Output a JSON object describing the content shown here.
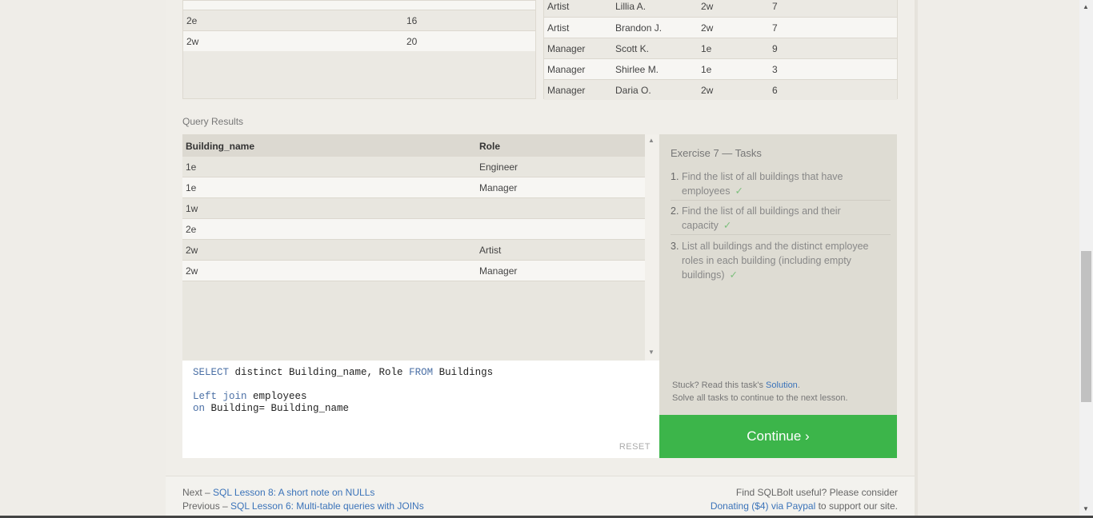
{
  "buildings_table": {
    "rows": [
      {
        "building": "2e",
        "capacity": "16"
      },
      {
        "building": "2w",
        "capacity": "20"
      }
    ]
  },
  "employees_table": {
    "rows": [
      {
        "role": "Artist",
        "name": "Lillia A.",
        "building": "2w",
        "years": "7"
      },
      {
        "role": "Artist",
        "name": "Brandon J.",
        "building": "2w",
        "years": "7"
      },
      {
        "role": "Manager",
        "name": "Scott K.",
        "building": "1e",
        "years": "9"
      },
      {
        "role": "Manager",
        "name": "Shirlee M.",
        "building": "1e",
        "years": "3"
      },
      {
        "role": "Manager",
        "name": "Daria O.",
        "building": "2w",
        "years": "6"
      }
    ]
  },
  "query_results": {
    "label": "Query Results",
    "columns": [
      "Building_name",
      "Role"
    ],
    "rows": [
      [
        "1e",
        "Engineer"
      ],
      [
        "1e",
        "Manager"
      ],
      [
        "1w",
        ""
      ],
      [
        "2e",
        ""
      ],
      [
        "2w",
        "Artist"
      ],
      [
        "2w",
        "Manager"
      ]
    ]
  },
  "editor": {
    "line1_kw1": "SELECT",
    "line1_rest": " distinct Building_name, Role ",
    "line1_kw2": "FROM",
    "line1_end": " Buildings",
    "line3_kw": "Left join",
    "line3_rest": " employees",
    "line4_kw": "on",
    "line4_rest": " Building= Building_name",
    "reset_label": "RESET"
  },
  "tasks": {
    "title": "Exercise 7 — Tasks",
    "items": [
      {
        "num": "1.",
        "text": "Find the list of all buildings that have employees",
        "check": "✓"
      },
      {
        "num": "2.",
        "text": "Find the list of all buildings and their capacity",
        "check": "✓"
      },
      {
        "num": "3.",
        "text": "List all buildings and the distinct employee roles in each building (including empty buildings)",
        "check": "✓"
      }
    ],
    "stuck_prefix": "Stuck? Read this task's ",
    "stuck_link": "Solution",
    "stuck_suffix": ".",
    "solve_all": "Solve all tasks to continue to the next lesson."
  },
  "continue_label": "Continue ›",
  "footer": {
    "next_prefix": "Next – ",
    "next_link": "SQL Lesson 8: A short note on NULLs",
    "prev_prefix": "Previous – ",
    "prev_link": "SQL Lesson 6: Multi-table queries with JOINs",
    "useful": "Find SQLBolt useful? Please consider",
    "donate_link": "Donating ($4) via Paypal",
    "support": " to support our site."
  },
  "colors": {
    "accent_green": "#3cb54a",
    "link_blue": "#3b73b9",
    "check_green": "#7cbf7c"
  }
}
